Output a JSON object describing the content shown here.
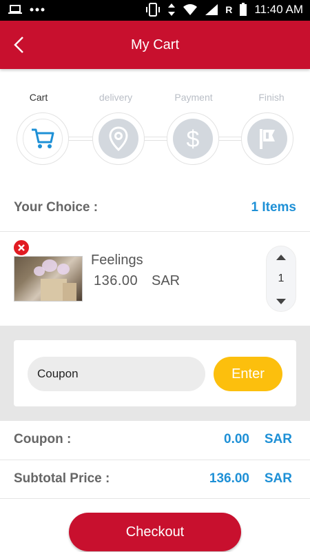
{
  "status_bar": {
    "time": "11:40 AM",
    "roaming": "R"
  },
  "header": {
    "title": "My Cart"
  },
  "steps": [
    {
      "label": "Cart",
      "icon": "cart-icon",
      "active": true
    },
    {
      "label": "delivery",
      "icon": "location-pin-icon",
      "active": false
    },
    {
      "label": "Payment",
      "icon": "dollar-icon",
      "active": false
    },
    {
      "label": "Finish",
      "icon": "flag-icon",
      "active": false
    }
  ],
  "choice": {
    "label": "Your Choice :",
    "count": "1 Items"
  },
  "item": {
    "name": "Feelings",
    "price": "136.00",
    "currency": "SAR",
    "quantity": "1"
  },
  "coupon": {
    "placeholder": "Coupon",
    "button": "Enter"
  },
  "summary": {
    "coupon_label": "Coupon :",
    "coupon_value": "0.00",
    "coupon_currency": "SAR",
    "subtotal_label": "Subtotal Price :",
    "subtotal_value": "136.00",
    "subtotal_currency": "SAR"
  },
  "checkout": {
    "label": "Checkout"
  },
  "colors": {
    "brand": "#c8102e",
    "accent": "#1e90d6",
    "enter": "#fcbf0d"
  }
}
